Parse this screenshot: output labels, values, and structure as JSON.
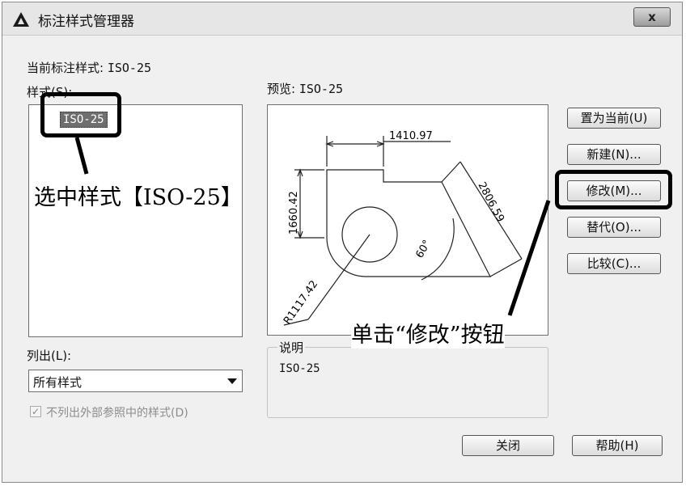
{
  "window": {
    "title": "标注样式管理器",
    "close_label": "x"
  },
  "current_style": {
    "label": "当前标注样式:",
    "value": "ISO-25"
  },
  "styles_panel": {
    "label": "样式(S):",
    "items": [
      "ISO-25"
    ]
  },
  "preview": {
    "label": "预览:",
    "name": "ISO-25",
    "dimensions": {
      "top": "1410.97",
      "left": "1660.42",
      "slant": "2806.59",
      "angle": "60°",
      "radius": "R1117.42"
    }
  },
  "buttons": {
    "set_current": "置为当前(U)",
    "new": "新建(N)...",
    "modify": "修改(M)...",
    "override": "替代(O)...",
    "compare": "比较(C)...",
    "close": "关闭",
    "help": "帮助(H)"
  },
  "list_filter": {
    "label": "列出(L):",
    "selected": "所有样式"
  },
  "checkbox": {
    "label": "不列出外部参照中的样式(D)",
    "checked": true
  },
  "description": {
    "label": "说明",
    "text": "ISO-25"
  },
  "annotations": {
    "select_style": "选中样式【ISO-25】",
    "click_modify": "单击“修改”按钮"
  }
}
